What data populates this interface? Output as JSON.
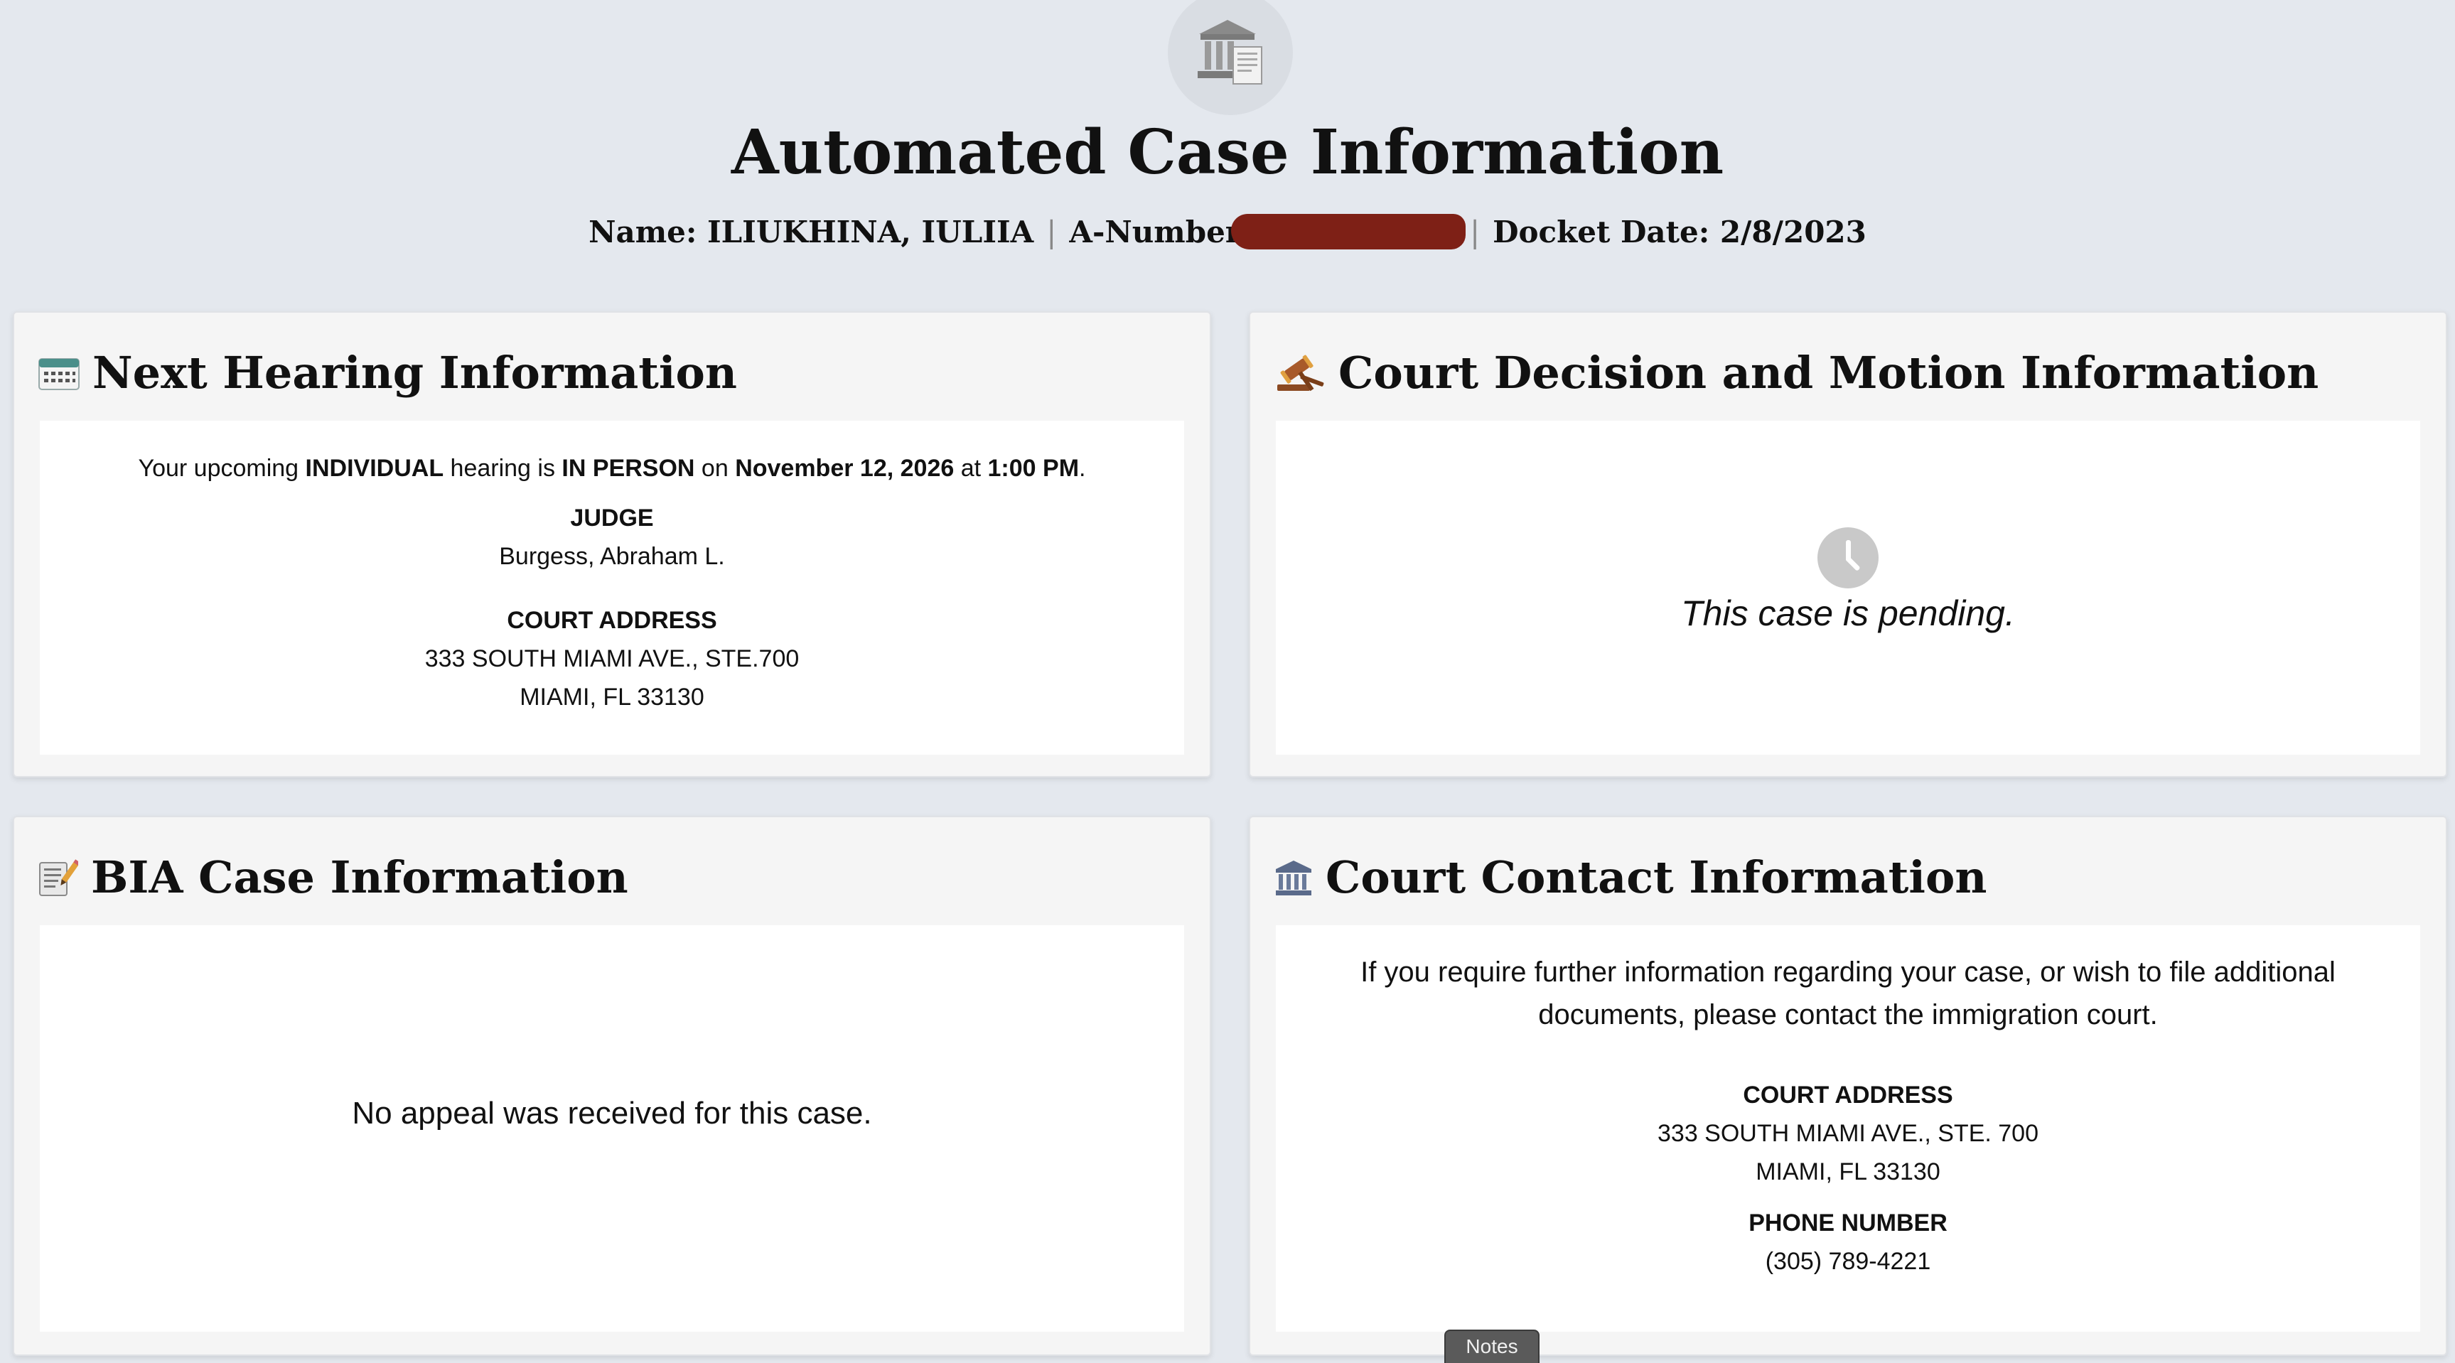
{
  "header": {
    "title": "Automated Case Information",
    "name_label": "Name: ILIUKHINA, IULIIA",
    "separator": "|",
    "anumber_label": "A-Number",
    "docket_label": "Docket Date: 2/8/2023",
    "logo_icon": "courthouse-document-icon"
  },
  "next_hearing": {
    "title": "Next Hearing Information",
    "icon": "calendar-icon",
    "line_prefix": "Your upcoming ",
    "hearing_type": "INDIVIDUAL",
    "line_mid1": " hearing is ",
    "hearing_mode": "IN PERSON",
    "line_mid2": " on ",
    "hearing_date": "November 12, 2026",
    "line_mid3": " at ",
    "hearing_time": "1:00 PM",
    "line_end": ".",
    "judge_label": "JUDGE",
    "judge_name": "Burgess, Abraham L.",
    "address_label": "COURT ADDRESS",
    "address_line1": "333 SOUTH MIAMI AVE., STE.700",
    "address_line2": "MIAMI, FL 33130"
  },
  "court_decision": {
    "title": "Court Decision and Motion Information",
    "icon": "gavel-icon",
    "status_icon": "clock-icon",
    "status_text": "This case is pending."
  },
  "bia": {
    "title": "BIA Case Information",
    "icon": "memo-icon",
    "message": "No appeal was received for this case."
  },
  "court_contact": {
    "title": "Court Contact Information",
    "icon": "courthouse-icon",
    "intro": "If you require further information regarding your case, or wish to file additional documents, please contact the immigration court.",
    "address_label": "COURT ADDRESS",
    "address_line1": "333 SOUTH MIAMI AVE., STE. 700",
    "address_line2": "MIAMI, FL 33130",
    "phone_label": "PHONE NUMBER",
    "phone": "(305) 789-4221"
  },
  "notes_tab": {
    "label": "Notes"
  },
  "colors": {
    "background": "#e4e8ee",
    "card": "#f5f5f5",
    "redaction": "#7e2016"
  }
}
